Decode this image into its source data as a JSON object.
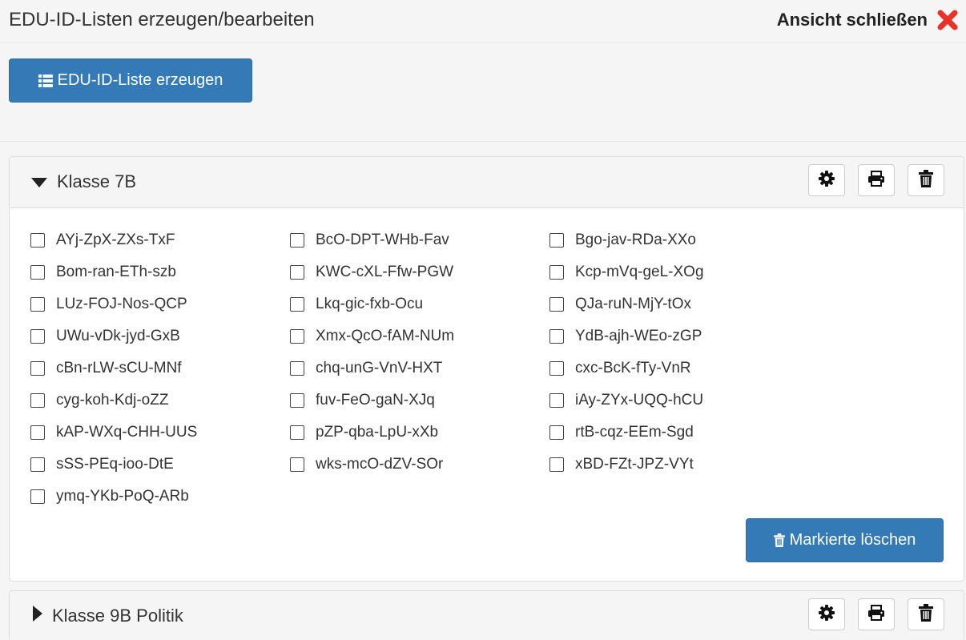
{
  "header": {
    "title": "EDU-ID-Listen erzeugen/bearbeiten",
    "close_label": "Ansicht schließen"
  },
  "toolbar": {
    "create_label": "EDU-ID-Liste erzeugen"
  },
  "panels": [
    {
      "title": "Klasse 7B",
      "expanded": true,
      "ids": [
        [
          "AYj-ZpX-ZXs-TxF",
          "BcO-DPT-WHb-Fav",
          "Bgo-jav-RDa-XXo"
        ],
        [
          "Bom-ran-ETh-szb",
          "KWC-cXL-Ffw-PGW",
          "Kcp-mVq-geL-XOg"
        ],
        [
          "LUz-FOJ-Nos-QCP",
          "Lkq-gic-fxb-Ocu",
          "QJa-ruN-MjY-tOx"
        ],
        [
          "UWu-vDk-jyd-GxB",
          "Xmx-QcO-fAM-NUm",
          "YdB-ajh-WEo-zGP"
        ],
        [
          "cBn-rLW-sCU-MNf",
          "chq-unG-VnV-HXT",
          "cxc-BcK-fTy-VnR"
        ],
        [
          "cyg-koh-Kdj-oZZ",
          "fuv-FeO-gaN-XJq",
          "iAy-ZYx-UQQ-hCU"
        ],
        [
          "kAP-WXq-CHH-UUS",
          "pZP-qba-LpU-xXb",
          "rtB-cqz-EEm-Sgd"
        ],
        [
          "sSS-PEq-ioo-DtE",
          "wks-mcO-dZV-SOr",
          "xBD-FZt-JPZ-VYt"
        ],
        [
          "ymq-YKb-PoQ-ARb"
        ]
      ],
      "delete_marked_label": "Markierte löschen"
    },
    {
      "title": "Klasse 9B Politik",
      "expanded": false
    }
  ],
  "icons": {
    "close": "close-icon",
    "list": "list-icon",
    "settings": "gear-icon",
    "print": "print-icon",
    "delete": "trash-icon",
    "expanded": "caret-down-icon",
    "collapsed": "caret-right-icon"
  },
  "colors": {
    "primary": "#337ab7",
    "close_red": "#e8332a"
  }
}
